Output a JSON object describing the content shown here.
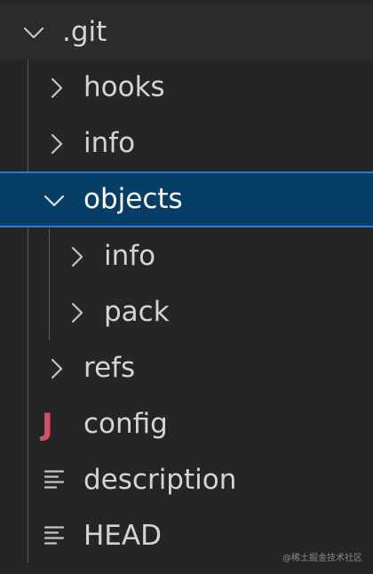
{
  "tree": {
    "root": {
      "label": ".git",
      "icon": "chevron-down-icon"
    },
    "items": [
      {
        "label": "hooks",
        "icon": "chevron-right-icon"
      },
      {
        "label": "info",
        "icon": "chevron-right-icon"
      },
      {
        "label": "objects",
        "icon": "chevron-down-icon",
        "selected": true
      },
      {
        "label": "info",
        "icon": "chevron-right-icon"
      },
      {
        "label": "pack",
        "icon": "chevron-right-icon"
      },
      {
        "label": "refs",
        "icon": "chevron-right-icon"
      },
      {
        "label": "config",
        "icon": "java-file-icon",
        "icon_glyph": "J"
      },
      {
        "label": "description",
        "icon": "text-lines-icon"
      },
      {
        "label": "HEAD",
        "icon": "text-lines-icon"
      }
    ]
  },
  "watermark": "@稀土掘金技术社区",
  "colors": {
    "background": "#252526",
    "selected_background": "#053e66",
    "selected_border": "#1f7fd6",
    "text": "#d4d4d4",
    "icon": "#c5c5c5",
    "java_icon": "#d05365"
  }
}
